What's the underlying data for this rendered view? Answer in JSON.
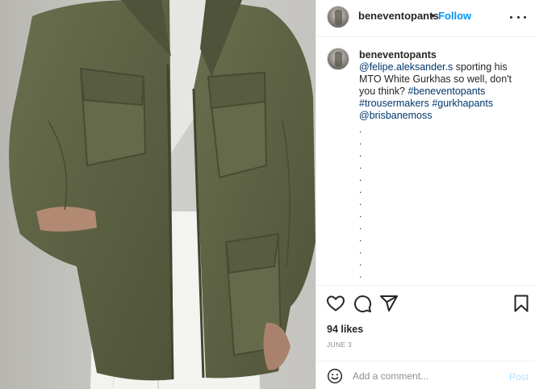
{
  "post": {
    "author": "beneventopants",
    "separator": "•",
    "follow_label": "Follow",
    "more_icon": "more-horizontal-icon"
  },
  "caption": {
    "author": "beneventopants",
    "mention_1": "@felipe.aleksander.s",
    "text": "sporting his MTO White Gurkhas so well, don't you think?",
    "hashtag_1": "#beneventopants",
    "hashtag_2": "#trousermakers",
    "hashtag_3": "#gurkhapants",
    "mention_2": "@brisbanemoss",
    "dots": [
      ".",
      ".",
      ".",
      ".",
      ".",
      ".",
      ".",
      ".",
      ".",
      ".",
      ".",
      ".",
      ".",
      "."
    ]
  },
  "actions": {
    "icons": [
      "heart-icon",
      "comment-icon",
      "share-icon",
      "bookmark-icon"
    ],
    "likes": "94 likes",
    "date": "JUNE 3"
  },
  "comment": {
    "placeholder": "Add a comment...",
    "post_label": "Post",
    "emoji_icon": "emoji-icon"
  },
  "colors": {
    "accent": "#0095f6",
    "link": "#00376b",
    "muted": "#8e8e8e",
    "post_disabled": "#b2dffc",
    "jacket": "#5f6446"
  }
}
